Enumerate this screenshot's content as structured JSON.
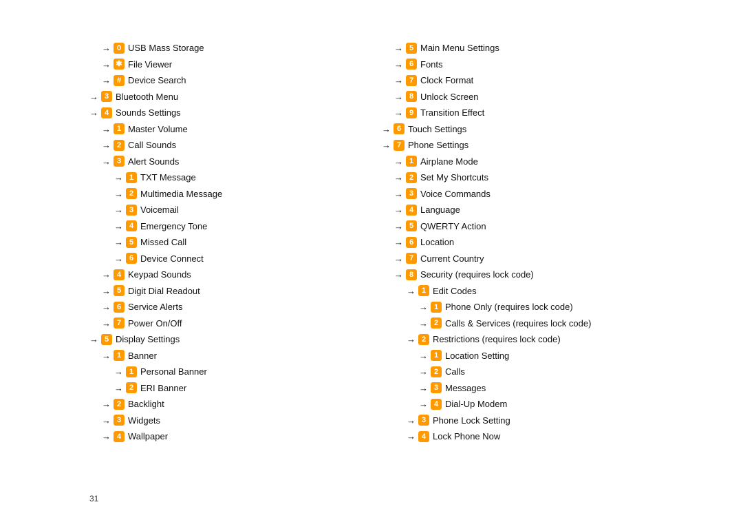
{
  "pageNumber": "31",
  "leftColumn": [
    {
      "indent": 1,
      "badge": "0",
      "label": "USB Mass Storage"
    },
    {
      "indent": 1,
      "badge": "✱",
      "label": "File Viewer"
    },
    {
      "indent": 1,
      "badge": "#",
      "label": "Device Search"
    },
    {
      "indent": 0,
      "badge": "3",
      "label": "Bluetooth Menu"
    },
    {
      "indent": 0,
      "badge": "4",
      "label": "Sounds Settings"
    },
    {
      "indent": 1,
      "badge": "1",
      "label": "Master Volume"
    },
    {
      "indent": 1,
      "badge": "2",
      "label": "Call Sounds"
    },
    {
      "indent": 1,
      "badge": "3",
      "label": "Alert Sounds"
    },
    {
      "indent": 2,
      "badge": "1",
      "label": "TXT Message"
    },
    {
      "indent": 2,
      "badge": "2",
      "label": "Multimedia Message"
    },
    {
      "indent": 2,
      "badge": "3",
      "label": "Voicemail"
    },
    {
      "indent": 2,
      "badge": "4",
      "label": "Emergency Tone"
    },
    {
      "indent": 2,
      "badge": "5",
      "label": "Missed Call"
    },
    {
      "indent": 2,
      "badge": "6",
      "label": "Device Connect"
    },
    {
      "indent": 1,
      "badge": "4",
      "label": "Keypad Sounds"
    },
    {
      "indent": 1,
      "badge": "5",
      "label": "Digit Dial Readout"
    },
    {
      "indent": 1,
      "badge": "6",
      "label": "Service Alerts"
    },
    {
      "indent": 1,
      "badge": "7",
      "label": "Power On/Off"
    },
    {
      "indent": 0,
      "badge": "5",
      "label": "Display Settings"
    },
    {
      "indent": 1,
      "badge": "1",
      "label": "Banner"
    },
    {
      "indent": 2,
      "badge": "1",
      "label": "Personal Banner"
    },
    {
      "indent": 2,
      "badge": "2",
      "label": "ERI Banner"
    },
    {
      "indent": 1,
      "badge": "2",
      "label": "Backlight"
    },
    {
      "indent": 1,
      "badge": "3",
      "label": "Widgets"
    },
    {
      "indent": 1,
      "badge": "4",
      "label": "Wallpaper"
    }
  ],
  "rightColumn": [
    {
      "indent": 1,
      "badge": "5",
      "label": "Main Menu Settings"
    },
    {
      "indent": 1,
      "badge": "6",
      "label": "Fonts"
    },
    {
      "indent": 1,
      "badge": "7",
      "label": "Clock Format"
    },
    {
      "indent": 1,
      "badge": "8",
      "label": "Unlock Screen"
    },
    {
      "indent": 1,
      "badge": "9",
      "label": "Transition Effect"
    },
    {
      "indent": 0,
      "badge": "6",
      "label": "Touch Settings"
    },
    {
      "indent": 0,
      "badge": "7",
      "label": "Phone Settings"
    },
    {
      "indent": 1,
      "badge": "1",
      "label": "Airplane Mode"
    },
    {
      "indent": 1,
      "badge": "2",
      "label": "Set My Shortcuts"
    },
    {
      "indent": 1,
      "badge": "3",
      "label": "Voice Commands"
    },
    {
      "indent": 1,
      "badge": "4",
      "label": "Language"
    },
    {
      "indent": 1,
      "badge": "5",
      "label": "QWERTY Action"
    },
    {
      "indent": 1,
      "badge": "6",
      "label": "Location"
    },
    {
      "indent": 1,
      "badge": "7",
      "label": "Current Country"
    },
    {
      "indent": 1,
      "badge": "8",
      "label": "Security (requires lock code)"
    },
    {
      "indent": 2,
      "badge": "1",
      "label": "Edit Codes"
    },
    {
      "indent": 3,
      "badge": "1",
      "label": "Phone Only (requires lock code)"
    },
    {
      "indent": 3,
      "badge": "2",
      "label": "Calls & Services (requires lock code)"
    },
    {
      "indent": 2,
      "badge": "2",
      "label": "Restrictions (requires lock code)"
    },
    {
      "indent": 3,
      "badge": "1",
      "label": "Location Setting"
    },
    {
      "indent": 3,
      "badge": "2",
      "label": "Calls"
    },
    {
      "indent": 3,
      "badge": "3",
      "label": "Messages"
    },
    {
      "indent": 3,
      "badge": "4",
      "label": "Dial-Up Modem"
    },
    {
      "indent": 2,
      "badge": "3",
      "label": "Phone Lock Setting"
    },
    {
      "indent": 2,
      "badge": "4",
      "label": "Lock Phone Now"
    }
  ]
}
